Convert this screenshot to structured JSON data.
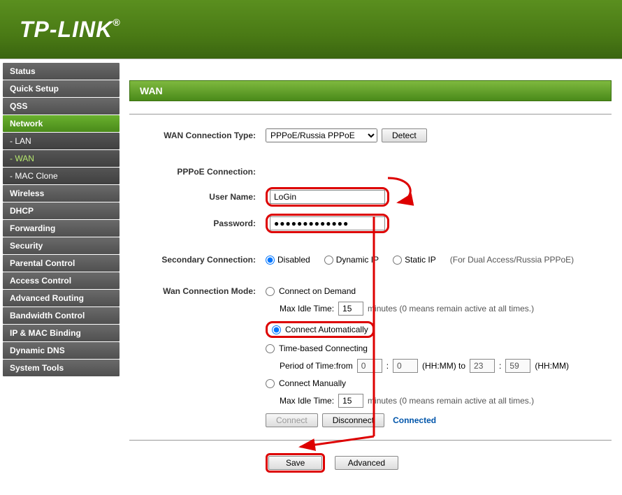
{
  "brand": "TP-LINK",
  "sidebar": {
    "items": [
      {
        "label": "Status",
        "type": "item"
      },
      {
        "label": "Quick Setup",
        "type": "item"
      },
      {
        "label": "QSS",
        "type": "item"
      },
      {
        "label": "Network",
        "type": "active-parent"
      },
      {
        "label": "- LAN",
        "type": "sub"
      },
      {
        "label": "- WAN",
        "type": "sub-active"
      },
      {
        "label": "- MAC Clone",
        "type": "sub"
      },
      {
        "label": "Wireless",
        "type": "item"
      },
      {
        "label": "DHCP",
        "type": "item"
      },
      {
        "label": "Forwarding",
        "type": "item"
      },
      {
        "label": "Security",
        "type": "item"
      },
      {
        "label": "Parental Control",
        "type": "item"
      },
      {
        "label": "Access Control",
        "type": "item"
      },
      {
        "label": "Advanced Routing",
        "type": "item"
      },
      {
        "label": "Bandwidth Control",
        "type": "item"
      },
      {
        "label": "IP & MAC Binding",
        "type": "item"
      },
      {
        "label": "Dynamic DNS",
        "type": "item"
      },
      {
        "label": "System Tools",
        "type": "item"
      }
    ]
  },
  "page": {
    "title": "WAN",
    "labels": {
      "conn_type": "WAN Connection Type:",
      "pppoe_conn": "PPPoE Connection:",
      "username": "User Name:",
      "password": "Password:",
      "secondary": "Secondary Connection:",
      "mode": "Wan Connection Mode:"
    },
    "conn_type_value": "PPPoE/Russia PPPoE",
    "detect_btn": "Detect",
    "username_value": "LoGin",
    "password_value": "●●●●●●●●●●●●●",
    "secondary": {
      "disabled": "Disabled",
      "dynamic": "Dynamic IP",
      "static": "Static IP",
      "note": "(For Dual Access/Russia PPPoE)"
    },
    "mode": {
      "on_demand": "Connect on Demand",
      "max_idle_label": "Max Idle Time:",
      "max_idle_value": "15",
      "max_idle_note": "minutes (0 means remain active at all times.)",
      "auto": "Connect Automatically",
      "time_based": "Time-based Connecting",
      "period_label": "Period of Time:from",
      "p_from_h": "0",
      "p_from_m": "0",
      "hhmm": "(HH:MM) to",
      "p_to_h": "23",
      "p_to_m": "59",
      "hhmm2": "(HH:MM)",
      "manual": "Connect Manually",
      "max_idle2_value": "15",
      "connect_btn": "Connect",
      "disconnect_btn": "Disconnect",
      "status": "Connected"
    },
    "save_btn": "Save",
    "advanced_btn": "Advanced"
  }
}
